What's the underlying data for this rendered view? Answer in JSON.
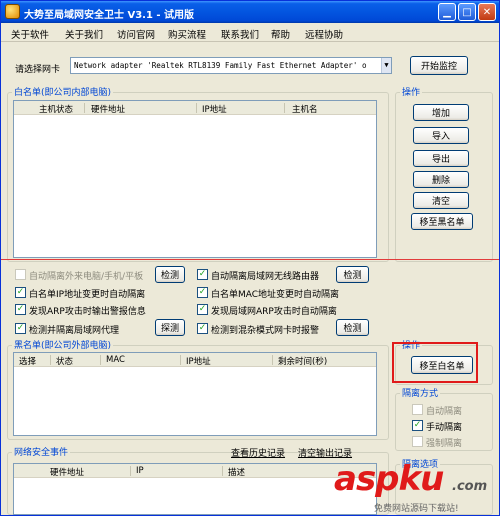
{
  "window": {
    "title": "大势至局域网安全卫士 V3.1 - 试用版"
  },
  "menu": [
    "关于软件",
    "关于我们",
    "访问官网",
    "购买流程",
    "联系我们",
    "帮助",
    "远程协助"
  ],
  "nic": {
    "label": "请选择网卡",
    "value": "Network adapter 'Realtek RTL8139 Family Fast Ethernet Adapter' o",
    "start_button": "开始监控"
  },
  "whitelist": {
    "title": "白名单(即公司内部电脑)",
    "columns": [
      "主机状态",
      "硬件地址",
      "IP地址",
      "主机名"
    ]
  },
  "ops": {
    "title": "操作",
    "buttons": [
      "增加",
      "导入",
      "导出",
      "删除",
      "清空",
      "移至黑名单"
    ]
  },
  "options": [
    {
      "label": "自动隔离外来电脑/手机/平板",
      "checked": false,
      "disabled": true,
      "button": "检测"
    },
    {
      "label": "自动隔离局域网无线路由器",
      "checked": true,
      "disabled": false,
      "button": "检测"
    },
    {
      "label": "白名单IP地址变更时自动隔离",
      "checked": true,
      "disabled": false
    },
    {
      "label": "白名单MAC地址变更时自动隔离",
      "checked": true,
      "disabled": false
    },
    {
      "label": "发现ARP攻击时输出警报信息",
      "checked": true,
      "disabled": false
    },
    {
      "label": "发现局域网ARP攻击时自动隔离",
      "checked": true,
      "disabled": false
    },
    {
      "label": "检测并隔离局域网代理",
      "checked": true,
      "disabled": false,
      "button": "探测"
    },
    {
      "label": "检测到混杂模式网卡时报警",
      "checked": true,
      "disabled": false,
      "button": "检测"
    }
  ],
  "blacklist": {
    "title": "黑名单(即公司外部电脑)",
    "columns": [
      "选择",
      "状态",
      "MAC",
      "IP地址",
      "剩余时间(秒)"
    ]
  },
  "ops2": {
    "title": "操作",
    "move_button": "移至白名单"
  },
  "isolation": {
    "title": "隔离方式",
    "options": [
      {
        "label": "自动隔离",
        "checked": false,
        "disabled": true
      },
      {
        "label": "手动隔离",
        "checked": true,
        "disabled": false
      },
      {
        "label": "强制隔离",
        "checked": false,
        "disabled": true
      }
    ]
  },
  "events": {
    "title": "网络安全事件",
    "history_link": "查看历史记录",
    "clear_link": "清空输出记录",
    "columns": [
      "硬件地址",
      "IP",
      "描述"
    ]
  },
  "bottom_right_title": "隔离选项",
  "watermark": {
    "brand": "aspku",
    "suffix": ".com",
    "tagline": "免费网站源码下载站!"
  },
  "colors": {
    "title_bar": "#0355e0",
    "group_title": "#0046d5",
    "highlight": "#e01a1a",
    "check": "#21a121"
  }
}
